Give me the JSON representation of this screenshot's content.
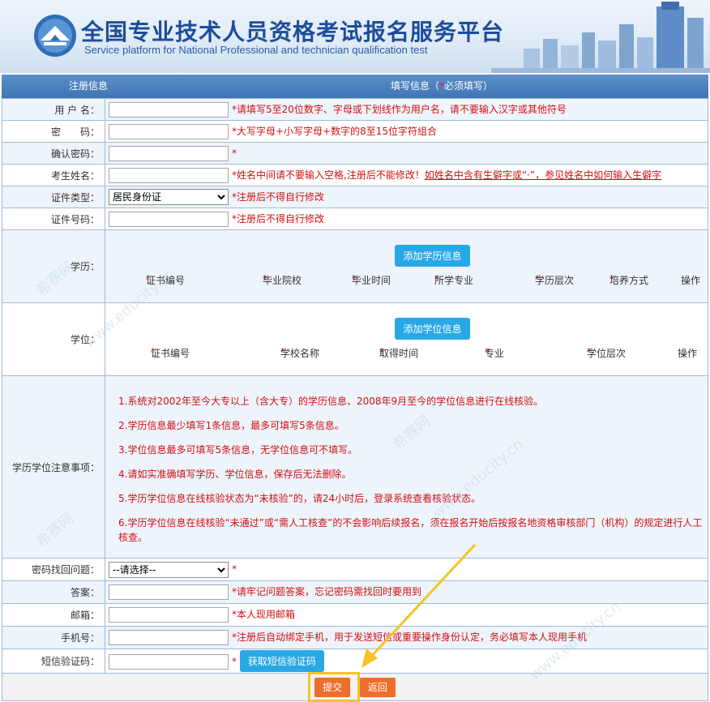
{
  "header": {
    "title_cn": "全国专业技术人员资格考试报名服务平台",
    "title_en": "Service platform for National Professional and technician  qualification test"
  },
  "columns": {
    "left": "注册信息",
    "right_pre": "填写信息（",
    "right_star": "*",
    "right_post": "必须填写）"
  },
  "fields": {
    "username": {
      "label": "用 户 名：",
      "hint": "*请填写5至20位数字、字母或下划线作为用户名，请不要输入汉字或其他符号"
    },
    "password": {
      "label": "密　　码：",
      "hint": "*大写字母+小写字母+数字的8至15位字符组合"
    },
    "confirm": {
      "label": "确认密码：",
      "hint": "*"
    },
    "realname": {
      "label": "考生姓名：",
      "hint": "*姓名中间请不要输入空格,注册后不能修改！",
      "link": "如姓名中含有生僻字或“·”，参见姓名中如何输入生僻字"
    },
    "id_type": {
      "label": "证件类型：",
      "value": "居民身份证",
      "hint": "*注册后不得自行修改"
    },
    "id_number": {
      "label": "证件号码：",
      "hint": "*注册后不得自行修改"
    },
    "education": {
      "label": "学历：",
      "button": "添加学历信息",
      "columns": [
        "证书编号",
        "毕业院校",
        "毕业时间",
        "所学专业",
        "学历层次",
        "培养方式"
      ],
      "action": "操作"
    },
    "degree": {
      "label": "学位：",
      "button": "添加学位信息",
      "columns": [
        "证书编号",
        "学校名称",
        "取得时间",
        "专业",
        "学位层次"
      ],
      "action": "操作"
    },
    "notes": {
      "label": "学历学位注意事项：",
      "items": [
        "1.系统对2002年至今大专以上（含大专）的学历信息、2008年9月至今的学位信息进行在线核验。",
        "2.学历信息最少填写1条信息，最多可填写5条信息。",
        "3.学位信息最多可填写5条信息，无学位信息可不填写。",
        "4.请如实准确填写学历、学位信息，保存后无法删除。",
        "5.学历学位信息在线核验状态为“未核验”的，请24小时后，登录系统查看核验状态。",
        "6.学历学位信息在线核验“未通过”或“需人工核查”的不会影响后续报名，须在报名开始后按报名地资格审核部门（机构）的规定进行人工核查。"
      ]
    },
    "question": {
      "label": "密码找回问题：",
      "value": "--请选择--",
      "hint": "*"
    },
    "answer": {
      "label": "答案：",
      "hint": "*请牢记问题答案，忘记密码需找回时要用到"
    },
    "email": {
      "label": "邮箱：",
      "hint": "*本人现用邮箱"
    },
    "phone": {
      "label": "手机号：",
      "hint": "*注册后自动绑定手机，用于发送短信或重要操作身份认定，务必填写本人现用手机"
    },
    "sms": {
      "label": "短信验证码：",
      "hint": "*",
      "button": "获取短信验证码"
    }
  },
  "actions": {
    "submit": "提交",
    "back": "返回"
  },
  "watermark": {
    "cn": "希赛网",
    "en": "www.educity.cn"
  },
  "colors": {
    "header_bar": "#4f84c0",
    "hint": "#d01010",
    "blue_button": "#29a8e6",
    "orange_button": "#ee6e2c",
    "highlight": "#f7c325"
  }
}
